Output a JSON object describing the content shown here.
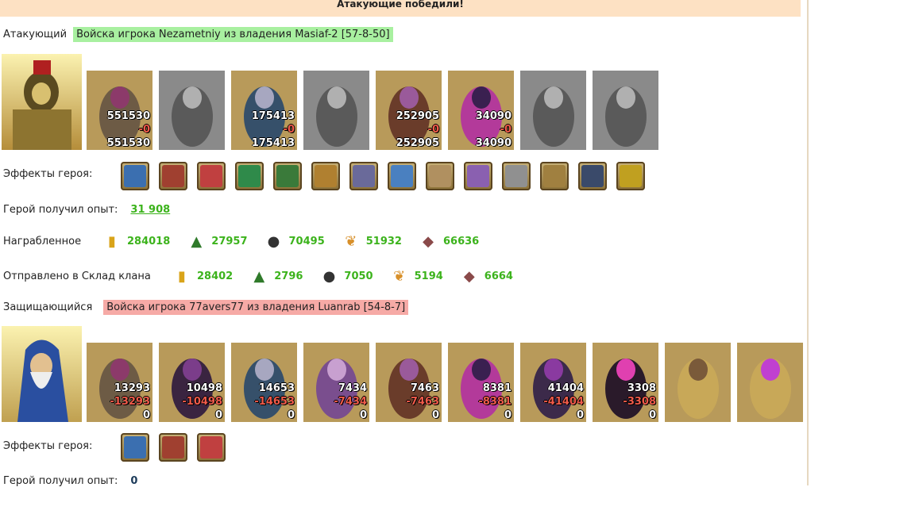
{
  "banner": "Атакующие победили!",
  "attacker": {
    "label": "Атакующий",
    "tag": "Войска игрока Nezametniy из владения Masiaf-2 [57-8-50]",
    "units": [
      {
        "icon": "golem-unit",
        "a": "551530",
        "b": "-0",
        "c": "551530"
      },
      {
        "icon": "assassin-unit-grey",
        "a": "",
        "b": "",
        "c": ""
      },
      {
        "icon": "lizard-knight-unit",
        "a": "175413",
        "b": "-0",
        "c": "175413"
      },
      {
        "icon": "harpy-unit-grey",
        "a": "",
        "b": "",
        "c": ""
      },
      {
        "icon": "dark-archer-unit",
        "a": "252905",
        "b": "-0",
        "c": "252905"
      },
      {
        "icon": "vampire-unit",
        "a": "34090",
        "b": "-0",
        "c": "34090"
      },
      {
        "icon": "shadow-unit-grey",
        "a": "",
        "b": "",
        "c": ""
      },
      {
        "icon": "spider-unit-grey",
        "a": "",
        "b": "",
        "c": ""
      }
    ],
    "effects_label": "Эффекты героя:",
    "effects": [
      "sword-icon",
      "castle-icon",
      "dice-icon",
      "shield-icon",
      "handshake-icon",
      "coins-icon",
      "amulet-icon",
      "question-icon",
      "angel-icon",
      "ring-icon",
      "scroll-icon",
      "dagger-icon",
      "crest-icon",
      "crown-icon"
    ],
    "xp_label": "Герой получил опыт:",
    "xp_value": "31 908",
    "loot_label": "Награбленное",
    "loot": [
      {
        "icon": "gold-icon",
        "value": "284018"
      },
      {
        "icon": "wood-icon",
        "value": "27957"
      },
      {
        "icon": "ore-icon",
        "value": "70495"
      },
      {
        "icon": "wheat-icon",
        "value": "51932"
      },
      {
        "icon": "iron-icon",
        "value": "66636"
      }
    ],
    "clan_label": "Отправлено в Склад клана",
    "clan": [
      {
        "icon": "gold-icon",
        "value": "28402"
      },
      {
        "icon": "wood-icon",
        "value": "2796"
      },
      {
        "icon": "ore-icon",
        "value": "7050"
      },
      {
        "icon": "wheat-icon",
        "value": "5194"
      },
      {
        "icon": "iron-icon",
        "value": "6664"
      }
    ]
  },
  "defender": {
    "label": "Защищающийся",
    "tag": "Войска игрока 77avers77 из владения Luanrab [54-8-7]",
    "units": [
      {
        "icon": "golem-unit",
        "a": "13293",
        "b": "-13293",
        "c": "0"
      },
      {
        "icon": "assassin-unit",
        "a": "10498",
        "b": "-10498",
        "c": "0"
      },
      {
        "icon": "lizard-knight-unit",
        "a": "14653",
        "b": "-14653",
        "c": "0"
      },
      {
        "icon": "harpy-unit",
        "a": "7434",
        "b": "-7434",
        "c": "0"
      },
      {
        "icon": "dark-archer-unit",
        "a": "7463",
        "b": "-7463",
        "c": "0"
      },
      {
        "icon": "vampire-unit",
        "a": "8381",
        "b": "-8381",
        "c": "0"
      },
      {
        "icon": "shadow-unit",
        "a": "41404",
        "b": "-41404",
        "c": "0"
      },
      {
        "icon": "spider-unit",
        "a": "3308",
        "b": "-3308",
        "c": "0"
      },
      {
        "icon": "mole-unit",
        "a": "",
        "b": "",
        "c": ""
      },
      {
        "icon": "orb-unit",
        "a": "",
        "b": "",
        "c": ""
      }
    ],
    "effects_label": "Эффекты героя:",
    "effects": [
      "heart-icon",
      "heart-wing-icon",
      "potion-icon"
    ],
    "xp_label": "Герой получил опыт:",
    "xp_value": "0"
  },
  "colors": {
    "banner": "#fde1c3",
    "attacker_tag": "#a8f0a0",
    "defender_tag": "#f6aaa6",
    "resource_value": "#3cb31c"
  }
}
